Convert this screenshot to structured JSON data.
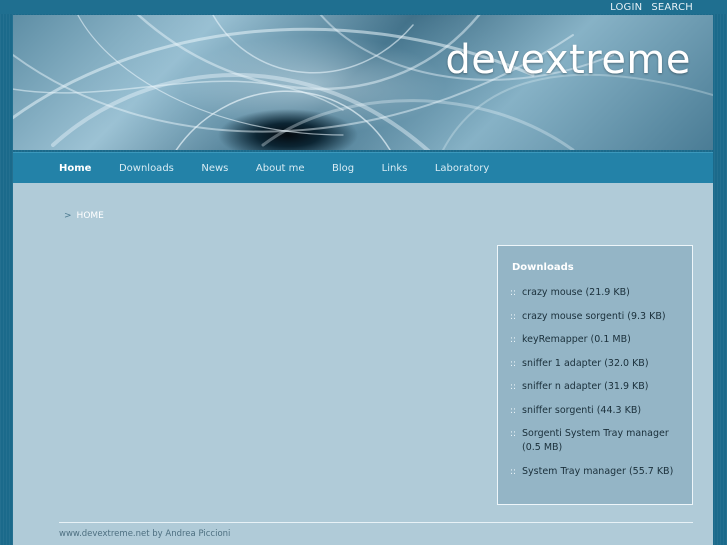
{
  "top_links": [
    "LOGIN",
    "SEARCH"
  ],
  "site_title": "devextreme",
  "nav": {
    "items": [
      "Home",
      "Downloads",
      "News",
      "About me",
      "Blog",
      "Links",
      "Laboratory"
    ],
    "active": "Home"
  },
  "breadcrumb": {
    "separator": ">",
    "current": "HOME"
  },
  "downloads_box": {
    "title": "Downloads",
    "bullet": "::",
    "items": [
      "crazy mouse (21.9 KB)",
      "crazy mouse sorgenti (9.3 KB)",
      "keyRemapper (0.1 MB)",
      "sniffer 1 adapter (32.0 KB)",
      "sniffer n adapter (31.9 KB)",
      "sniffer sorgenti (44.3 KB)",
      "Sorgenti System Tray manager (0.5 MB)",
      "System Tray manager (55.7 KB)"
    ]
  },
  "footer": "www.devextreme.net by Andrea Piccioni",
  "colors": {
    "background": "#1b6a8b",
    "navbar": "#2382a8",
    "content": "#b0cbd8",
    "sidebox": "#94b5c6"
  }
}
